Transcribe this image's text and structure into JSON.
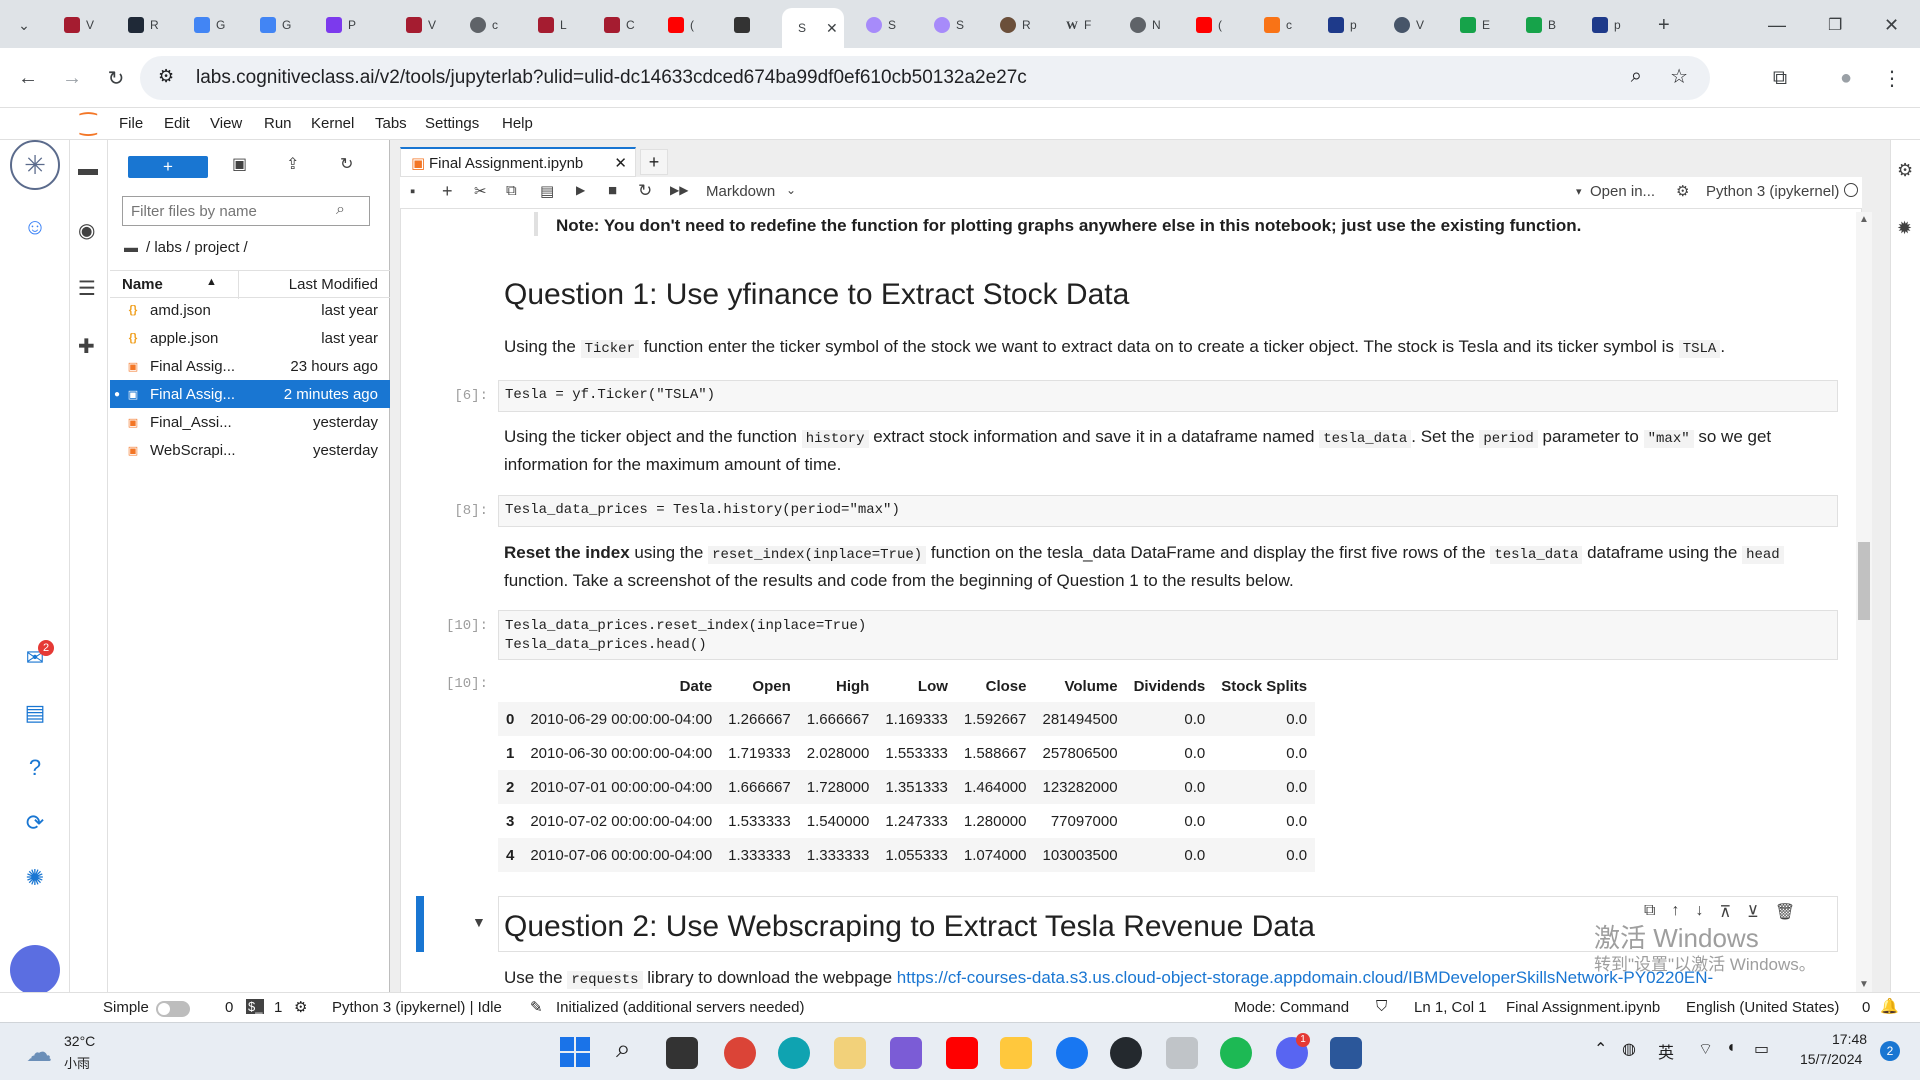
{
  "browser": {
    "tabs": [
      "V",
      "R",
      "G",
      "G",
      "P",
      "V",
      "c",
      "L",
      "C",
      "(",
      "",
      ""
    ],
    "active_tab_label": "S",
    "tabs_after": [
      "S",
      "S",
      "R",
      "F",
      "N",
      "(",
      "c",
      "p",
      "V",
      "E",
      "B",
      "p"
    ],
    "url": "labs.cognitiveclass.ai/v2/tools/jupyterlab?ulid=ulid-dc14633cdced674ba99df0ef610cb50132a2e27c"
  },
  "menu": [
    "File",
    "Edit",
    "View",
    "Run",
    "Kernel",
    "Tabs",
    "Settings",
    "Help"
  ],
  "filebrowser": {
    "new_label": "+",
    "filter_placeholder": "Filter files by name",
    "breadcrumb": "/ labs / project /",
    "col_name": "Name",
    "col_modified": "Last Modified",
    "files": [
      {
        "name": "amd.json",
        "modified": "last year",
        "type": "json"
      },
      {
        "name": "apple.json",
        "modified": "last year",
        "type": "json"
      },
      {
        "name": "Final Assig...",
        "modified": "23 hours ago",
        "type": "notebook"
      },
      {
        "name": "Final Assig...",
        "modified": "2 minutes ago",
        "type": "notebook",
        "selected": true
      },
      {
        "name": "Final_Assi...",
        "modified": "yesterday",
        "type": "notebook"
      },
      {
        "name": "WebScrapi...",
        "modified": "yesterday",
        "type": "notebook"
      }
    ]
  },
  "notebook": {
    "tab_title": "Final Assignment.ipynb",
    "cell_type": "Markdown",
    "open_in": "Open in...",
    "kernel": "Python 3 (ipykernel)",
    "note": "Note: You don't need to redefine the function for plotting graphs anywhere else in this notebook; just use the existing function.",
    "q1_title": "Question 1: Use yfinance to Extract Stock Data",
    "q1_p1_a": "Using the",
    "q1_p1_code": "Ticker",
    "q1_p1_b": "function enter the ticker symbol of the stock we want to extract data on to create a ticker object. The stock is Tesla and its ticker symbol is",
    "q1_p1_code2": "TSLA",
    "q1_p1_c": ".",
    "prompt6": "[6]:",
    "code6": "Tesla = yf.Ticker(\"TSLA\")",
    "q1_p2_a": "Using the ticker object and the function",
    "q1_p2_code1": "history",
    "q1_p2_b": "extract stock information and save it in a dataframe named",
    "q1_p2_code2": "tesla_data",
    "q1_p2_c": ". Set the",
    "q1_p2_code3": "period",
    "q1_p2_d": "parameter to",
    "q1_p2_code4": "\"max\"",
    "q1_p2_e": "so we get",
    "q1_p2_f": "information for the maximum amount of time.",
    "prompt8": "[8]:",
    "code8": "Tesla_data_prices = Tesla.history(period=\"max\")",
    "q1_p3_bold": "Reset the index",
    "q1_p3_a": "using the",
    "q1_p3_code1": "reset_index(inplace=True)",
    "q1_p3_b": "function on the tesla_data DataFrame and display the first five rows of the",
    "q1_p3_code2": "tesla_data",
    "q1_p3_c": "dataframe using the",
    "q1_p3_code3": "head",
    "q1_p3_d": "function. Take a screenshot of the results and code from the beginning of Question 1 to the results below.",
    "prompt10": "[10]:",
    "code10_line1": "Tesla_data_prices.reset_index(inplace=True)",
    "code10_line2": "Tesla_data_prices.head()",
    "out10": "[10]:",
    "table_columns": [
      "Date",
      "Open",
      "High",
      "Low",
      "Close",
      "Volume",
      "Dividends",
      "Stock Splits"
    ],
    "table_rows": [
      [
        "0",
        "2010-06-29 00:00:00-04:00",
        "1.266667",
        "1.666667",
        "1.169333",
        "1.592667",
        "281494500",
        "0.0",
        "0.0"
      ],
      [
        "1",
        "2010-06-30 00:00:00-04:00",
        "1.719333",
        "2.028000",
        "1.553333",
        "1.588667",
        "257806500",
        "0.0",
        "0.0"
      ],
      [
        "2",
        "2010-07-01 00:00:00-04:00",
        "1.666667",
        "1.728000",
        "1.351333",
        "1.464000",
        "123282000",
        "0.0",
        "0.0"
      ],
      [
        "3",
        "2010-07-02 00:00:00-04:00",
        "1.533333",
        "1.540000",
        "1.247333",
        "1.280000",
        "77097000",
        "0.0",
        "0.0"
      ],
      [
        "4",
        "2010-07-06 00:00:00-04:00",
        "1.333333",
        "1.333333",
        "1.055333",
        "1.074000",
        "103003500",
        "0.0",
        "0.0"
      ]
    ],
    "q2_title": "Question 2: Use Webscraping to Extract Tesla Revenue Data",
    "q2_p_a": "Use the",
    "q2_p_code": "requests",
    "q2_p_b": "library to download the webpage",
    "q2_link": "https://cf-courses-data.s3.us.cloud-object-storage.appdomain.cloud/IBMDeveloperSkillsNetwork-PY0220EN-",
    "watermark1": "激活 Windows",
    "watermark2": "转到\"设置\"以激活 Windows。"
  },
  "status": {
    "simple": "Simple",
    "zero": "0",
    "one": "1",
    "kernel": "Python 3 (ipykernel) | Idle",
    "init": "Initialized (additional servers needed)",
    "mode": "Mode: Command",
    "pos": "Ln 1, Col 1",
    "file": "Final Assignment.ipynb",
    "lang": "English (United States)",
    "count": "0"
  },
  "taskbar": {
    "temp": "32°C",
    "weather": "小雨",
    "ime": "英",
    "time": "17:48",
    "date": "15/7/2024",
    "notif": "2"
  },
  "badges": {
    "mail": "2",
    "discord": "1"
  }
}
